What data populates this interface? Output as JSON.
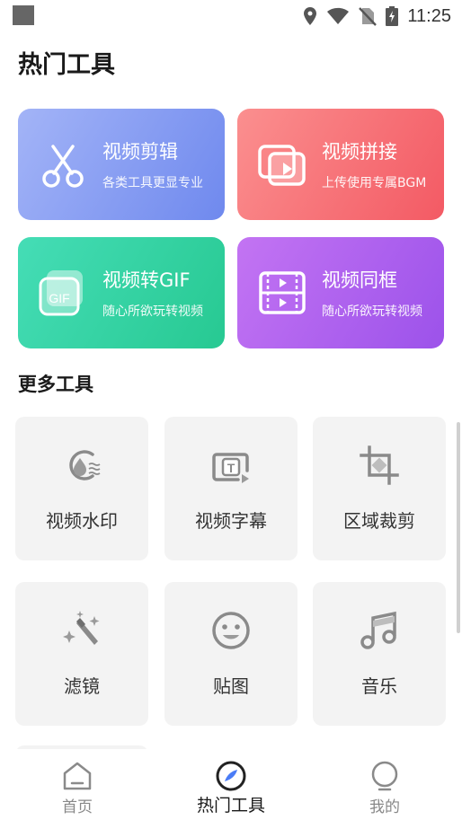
{
  "status_bar": {
    "time": "11:25",
    "icons": [
      "notification-square-icon",
      "location-icon",
      "wifi-icon",
      "no-sim-icon",
      "battery-charging-icon"
    ]
  },
  "page": {
    "title": "热门工具"
  },
  "features": [
    {
      "title": "视频剪辑",
      "subtitle": "各类工具更显专业",
      "icon": "scissors-icon",
      "colors": [
        "#a3b4f7",
        "#6f89ee"
      ]
    },
    {
      "title": "视频拼接",
      "subtitle": "上传使用专属BGM",
      "icon": "video-stack-icon",
      "colors": [
        "#fb8f8f",
        "#f35a64"
      ]
    },
    {
      "title": "视频转GIF",
      "subtitle": "随心所欲玩转视频",
      "icon": "gif-icon",
      "icon_text": "GIF",
      "colors": [
        "#45ddb6",
        "#27c992"
      ]
    },
    {
      "title": "视频同框",
      "subtitle": "随心所欲玩转视频",
      "icon": "split-video-icon",
      "colors": [
        "#c374f3",
        "#9c52ea"
      ]
    }
  ],
  "more": {
    "title": "更多工具",
    "tools": [
      {
        "label": "视频水印",
        "icon": "watermark-icon"
      },
      {
        "label": "视频字幕",
        "icon": "subtitle-icon",
        "icon_text": "T"
      },
      {
        "label": "区域裁剪",
        "icon": "crop-icon"
      },
      {
        "label": "滤镜",
        "icon": "magic-wand-icon"
      },
      {
        "label": "贴图",
        "icon": "sticker-face-icon"
      },
      {
        "label": "音乐",
        "icon": "music-note-icon"
      }
    ]
  },
  "bottom_nav": {
    "items": [
      {
        "label": "首页",
        "icon": "home-icon",
        "active": false
      },
      {
        "label": "热门工具",
        "icon": "tools-icon",
        "active": true
      },
      {
        "label": "我的",
        "icon": "profile-icon",
        "active": false
      }
    ],
    "active_color": "#1a1a1a",
    "inactive_color": "#888888"
  }
}
